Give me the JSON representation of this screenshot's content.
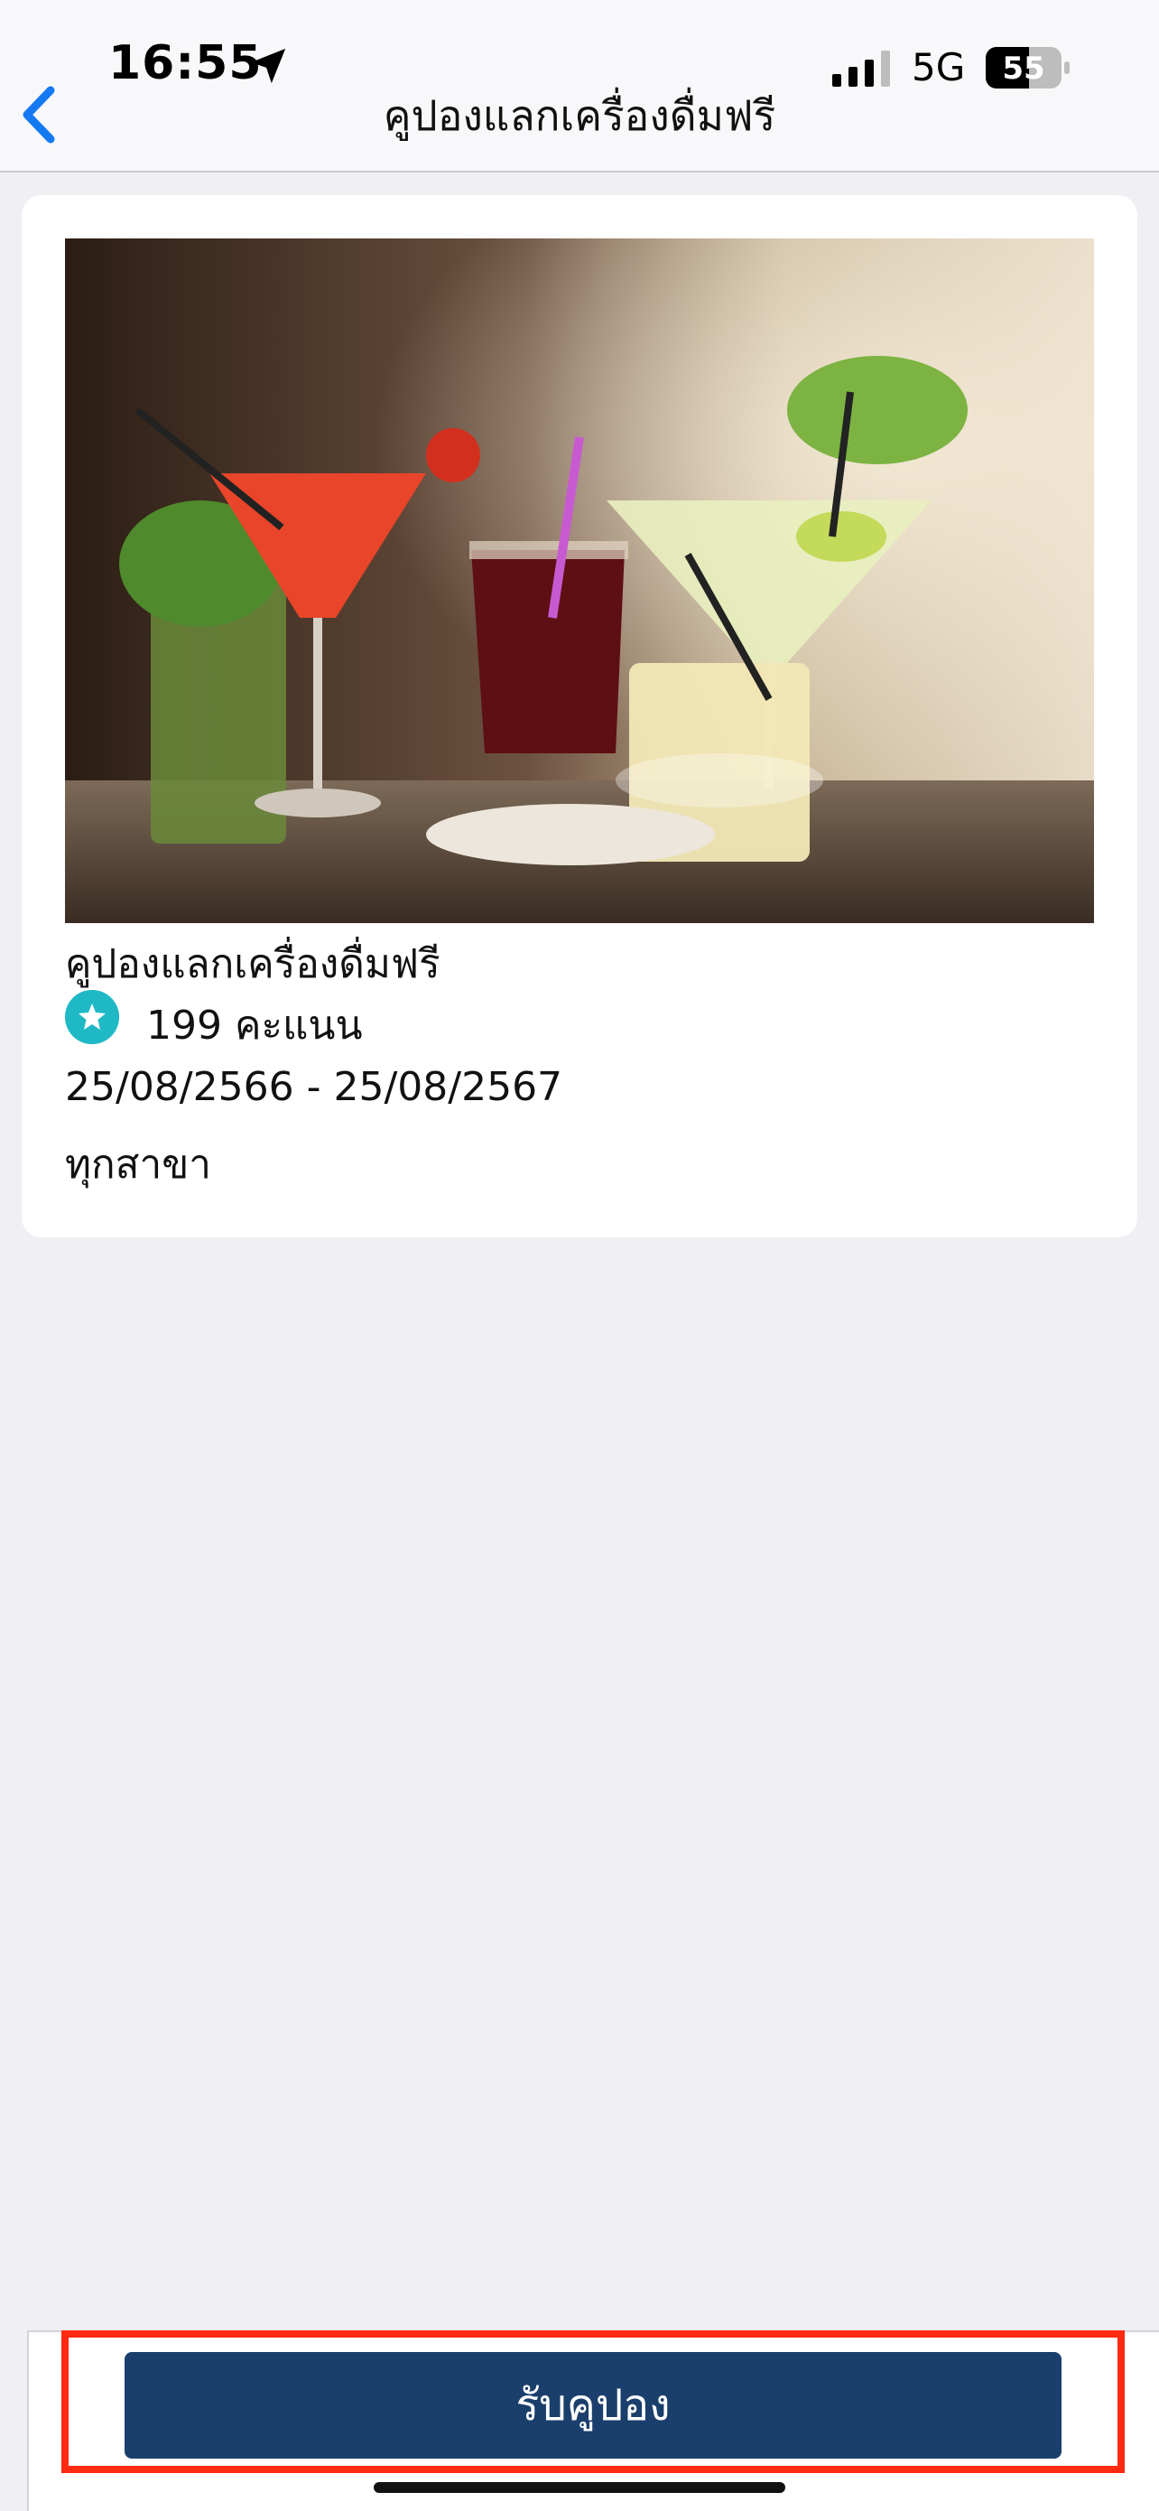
{
  "status_bar": {
    "time": "16:55",
    "network": "5G",
    "battery": "55",
    "icons": [
      "location-arrow-icon",
      "signal-bars-icon",
      "battery-icon"
    ]
  },
  "nav": {
    "title": "คูปองแลกเครื่องดื่มฟรี",
    "back_icon": "chevron-left-icon"
  },
  "coupon": {
    "image_icon": "cocktail-drinks-photo",
    "name": "คูปองแลกเครื่องดื่มฟรี",
    "points_icon": "star-badge-icon",
    "points": "199 คะแนน",
    "dates": "25/08/2566 - 25/08/2567",
    "branch": "ทุกสาขา"
  },
  "actions": {
    "redeem_label": "รับคูปอง"
  },
  "colors": {
    "accent": "#1b3f6c",
    "points_badge": "#1fb9c5",
    "highlight": "#ff2a12",
    "background": "#efeff4"
  }
}
